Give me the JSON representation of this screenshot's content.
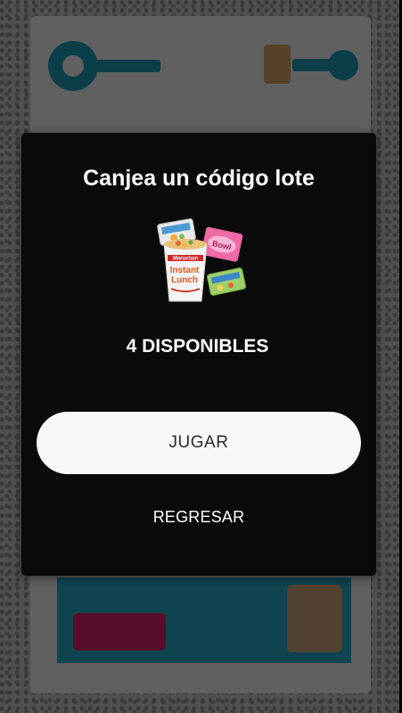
{
  "modal": {
    "title": "Canjea un código lote",
    "product_image": "instant-lunch-products-icon",
    "available_text": "4 DISPONIBLES",
    "play_label": "JUGAR",
    "back_label": "REGRESAR"
  },
  "colors": {
    "modal_background": "#0a0a0a",
    "primary_button": "#f7f8fa",
    "background_accent": "#1f9bb8",
    "background_button": "#d91f6e"
  }
}
